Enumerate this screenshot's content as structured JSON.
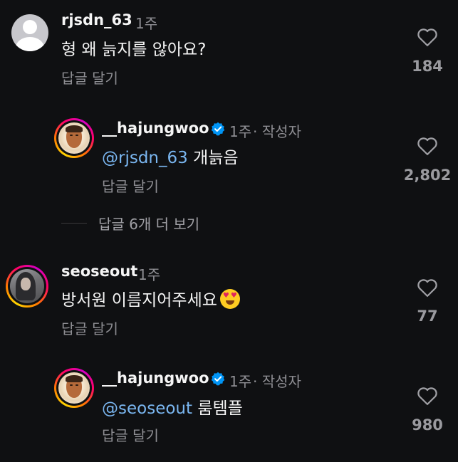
{
  "comments": [
    {
      "username": "rjsdn_63",
      "time": "1주",
      "text": "형 왜 늙지를 않아요?",
      "reply_label": "답글 달기",
      "likes": "184"
    },
    {
      "username": "__hajungwoo",
      "time": "1주",
      "author_tag": "· 작성자",
      "mention": "@rjsdn_63",
      "text": "개늙음",
      "reply_label": "답글 달기",
      "likes": "2,802"
    },
    {
      "username": "seoseout",
      "time": "1주",
      "text": "방서원 이름지어주세요",
      "emoji": "smiling-face-with-heart-eyes",
      "reply_label": "답글 달기",
      "likes": "77"
    },
    {
      "username": "__hajungwoo",
      "time": "1주",
      "author_tag": "· 작성자",
      "mention": "@seoseout",
      "text": "룸템플",
      "reply_label": "답글 달기",
      "likes": "980"
    }
  ],
  "view_more_replies": "답글 6개 더 보기",
  "colors": {
    "background": "#0f1012",
    "mention": "#7ab6f0",
    "verified": "#0095f6",
    "muted": "#8e8e93"
  }
}
